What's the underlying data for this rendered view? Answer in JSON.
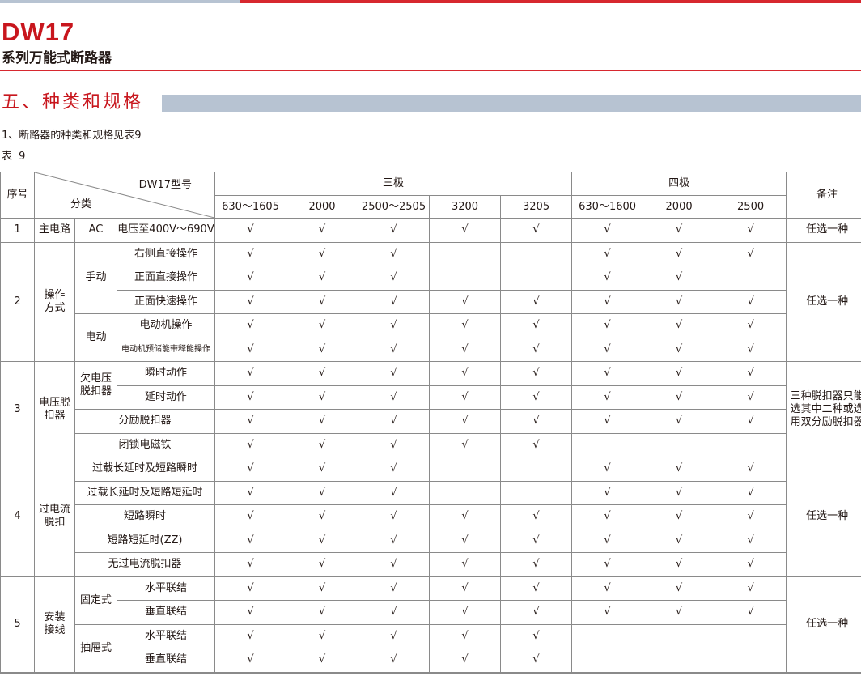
{
  "header": {
    "brand": "DW17",
    "subtitle": "系列万能式断路器",
    "section_title": "五、种类和规格",
    "note": "1、断路器的种类和规格见表9",
    "table_caption": "表 9",
    "accent_color": "#c8161d",
    "bar_color": "#b7c3d2"
  },
  "table": {
    "h_seq": "序号",
    "h_model": "DW17型号",
    "h_category": "分类",
    "h_three": "三极",
    "h_four": "四极",
    "h_remark": "备注",
    "three_sizes": [
      "630～1605",
      "2000",
      "2500～2505",
      "3200",
      "3205"
    ],
    "four_sizes": [
      "630～1600",
      "2000",
      "2500"
    ],
    "check": "√",
    "g1": {
      "no": "1",
      "a": "主电路",
      "b": "AC",
      "c": "电压至400V～690V",
      "remark": "任选一种"
    },
    "g2": {
      "no": "2",
      "group": "操作方式",
      "manual": "手动",
      "electric": "电动",
      "items": [
        "右侧直接操作",
        "正面直接操作",
        "正面快速操作",
        "电动机操作",
        "电动机预储能带释能操作"
      ],
      "remark": "任选一种"
    },
    "g3": {
      "no": "3",
      "group": "电压脱扣器",
      "sub": "欠电压脱扣器",
      "items": [
        "瞬时动作",
        "延时动作",
        "分励脱扣器",
        "闭锁电磁铁"
      ],
      "remark": "三种脱扣器只能选其中二种或选用双分励脱扣器"
    },
    "g4": {
      "no": "4",
      "group": "过电流脱扣",
      "items": [
        "过载长延时及短路瞬时",
        "过载长延时及短路短延时",
        "短路瞬时",
        "短路短延时(ZZ)",
        "无过电流脱扣器"
      ],
      "remark": "任选一种"
    },
    "g5": {
      "no": "5",
      "group": "安装接线",
      "fixed": "固定式",
      "drawer": "抽屉式",
      "items": [
        "水平联结",
        "垂直联结",
        "水平联结",
        "垂直联结"
      ],
      "remark": "任选一种"
    }
  }
}
